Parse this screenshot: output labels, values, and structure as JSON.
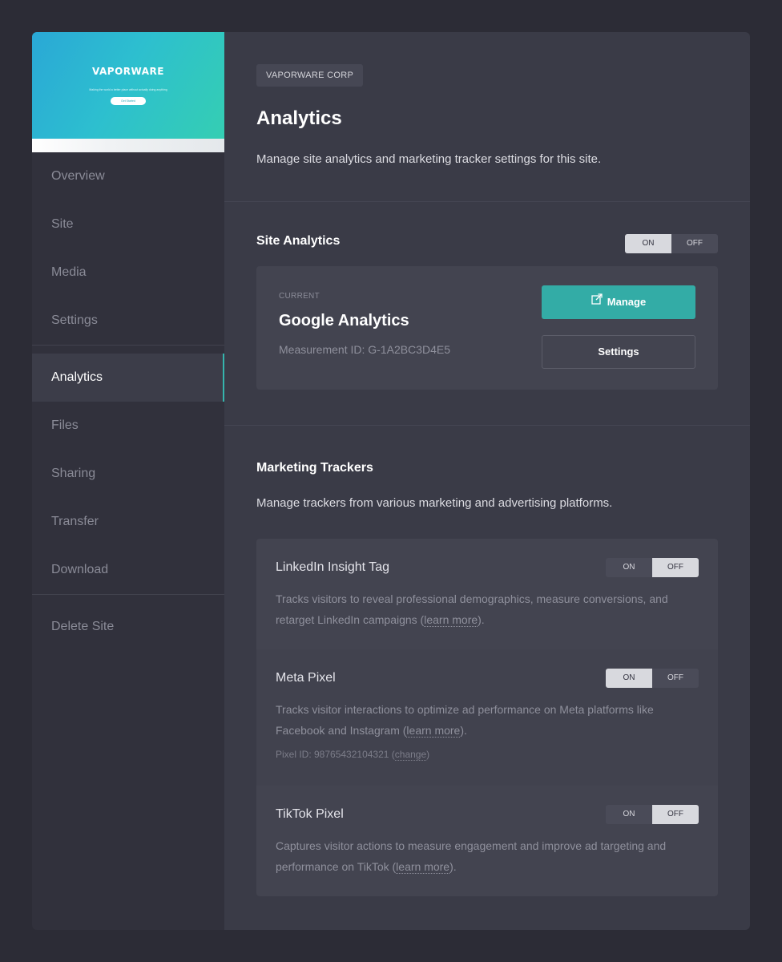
{
  "sidebar": {
    "preview": {
      "brand": "VAPORWARE",
      "tagline": "Making the world a better place without actually doing anything",
      "cta": "Get Started"
    },
    "group1": [
      "Overview",
      "Site",
      "Media",
      "Settings"
    ],
    "group2": [
      "Analytics",
      "Files",
      "Sharing",
      "Transfer",
      "Download"
    ],
    "group3": [
      "Delete Site"
    ],
    "active": "Analytics"
  },
  "header": {
    "breadcrumb": "VAPORWARE CORP",
    "title": "Analytics",
    "description": "Manage site analytics and marketing tracker settings for this site."
  },
  "site_analytics": {
    "title": "Site Analytics",
    "toggle": {
      "on_label": "ON",
      "off_label": "OFF",
      "state": "on"
    },
    "card": {
      "label": "CURRENT",
      "name": "Google Analytics",
      "measurement": "Measurement ID: G-1A2BC3D4E5",
      "manage_label": "Manage",
      "settings_label": "Settings"
    }
  },
  "trackers": {
    "title": "Marketing Trackers",
    "description": "Manage trackers from various marketing and advertising platforms.",
    "items": [
      {
        "name": "LinkedIn Insight Tag",
        "state": "off",
        "desc_pre": "Tracks visitors to reveal professional demographics, measure conversions, and retarget LinkedIn campaigns (",
        "link": "learn more",
        "desc_post": ")."
      },
      {
        "name": "Meta Pixel",
        "state": "on",
        "desc_pre": "Tracks visitor interactions to optimize ad performance on Meta platforms like Facebook and Instagram (",
        "link": "learn more",
        "desc_post": ").",
        "meta_pre": "Pixel ID: 98765432104321 (",
        "meta_link": "change",
        "meta_post": ")"
      },
      {
        "name": "TikTok Pixel",
        "state": "off",
        "desc_pre": "Captures visitor actions to measure engagement and improve ad targeting and performance on TikTok (",
        "link": "learn more",
        "desc_post": ")."
      }
    ],
    "on_label": "ON",
    "off_label": "OFF"
  },
  "colors": {
    "accent": "#33aca6",
    "background": "#2c2c36",
    "sidebar": "#31313c",
    "main": "#3a3b47"
  },
  "icons": {
    "manage": "external-link-icon"
  }
}
